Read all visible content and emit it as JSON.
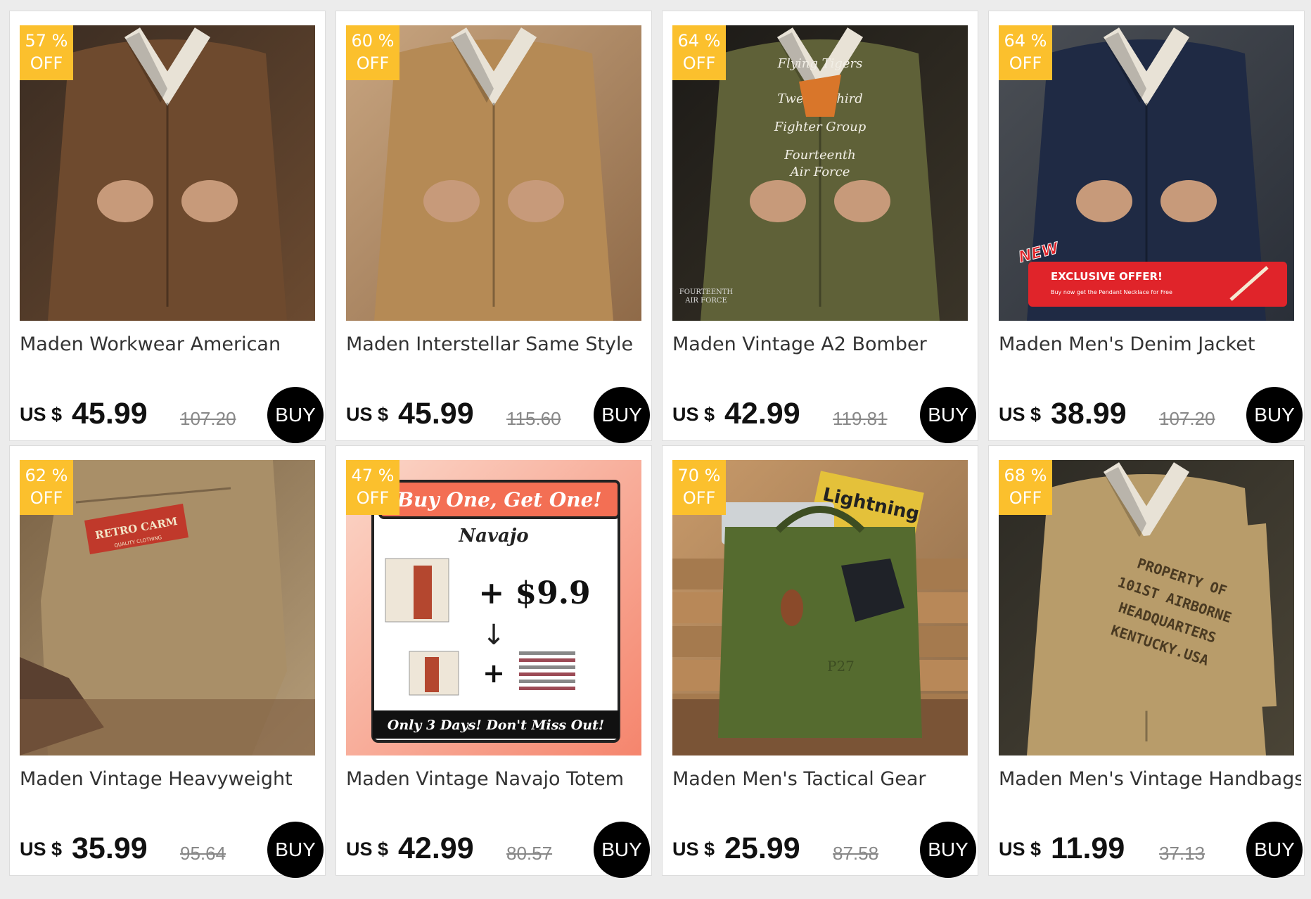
{
  "products": [
    {
      "discount_pct": "57 %",
      "off": "OFF",
      "title": "Maden Workwear American",
      "currency": "US $",
      "price": "45.99",
      "original_price": "107.20",
      "buy_label": "BUY",
      "image": "brown-work-jacket",
      "colors": {
        "bg1": "#3a2c22",
        "bg2": "#6b4a30",
        "main": "#6e4a2e"
      },
      "overlay": null
    },
    {
      "discount_pct": "60 %",
      "off": "OFF",
      "title": "Maden Interstellar Same Style",
      "currency": "US $",
      "price": "45.99",
      "original_price": "115.60",
      "buy_label": "BUY",
      "image": "tan-work-jacket",
      "colors": {
        "bg1": "#c8a580",
        "bg2": "#8f6a48",
        "main": "#b58a55"
      },
      "overlay": null
    },
    {
      "discount_pct": "64 %",
      "off": "OFF",
      "title": "Maden Vintage A2 Bomber",
      "currency": "US $",
      "price": "42.99",
      "original_price": "119.81",
      "buy_label": "BUY",
      "image": "green-bomber-jacket",
      "colors": {
        "bg1": "#1c1a17",
        "bg2": "#3a3428",
        "main": "#5f6138"
      },
      "overlay": {
        "kind": "embroidery",
        "lines": [
          "Flying Tigers",
          "Twenty Third",
          "Fighter Group",
          "Fourteenth",
          "Air Force"
        ],
        "corner": [
          "FOURTEENTH",
          "AIR FORCE"
        ]
      }
    },
    {
      "discount_pct": "64 %",
      "off": "OFF",
      "title": "Maden Men's Denim Jacket",
      "currency": "US $",
      "price": "38.99",
      "original_price": "107.20",
      "buy_label": "BUY",
      "image": "denim-jacket",
      "colors": {
        "bg1": "#4b4f55",
        "bg2": "#2a2f38",
        "main": "#1f2a44"
      },
      "overlay": {
        "kind": "promo",
        "new": "NEW",
        "headline": "EXCLUSIVE OFFER!",
        "sub": "Buy now get the Pendant Necklace for Free",
        "accent": "#e0242a"
      }
    },
    {
      "discount_pct": "62 %",
      "off": "OFF",
      "title": "Maden Vintage Heavyweight",
      "currency": "US $",
      "price": "35.99",
      "original_price": "95.64",
      "buy_label": "BUY",
      "image": "khaki-chino-pants",
      "colors": {
        "bg1": "#7a6245",
        "bg2": "#b49c78",
        "main": "#a98f68"
      },
      "overlay": {
        "kind": "label",
        "line1": "RETRO CARM",
        "line2": "QUALITY CLOTHING"
      }
    },
    {
      "discount_pct": "47 %",
      "off": "OFF",
      "title": "Maden Vintage Navajo Totem",
      "currency": "US $",
      "price": "42.99",
      "original_price": "80.57",
      "buy_label": "BUY",
      "image": "navajo-shorts-promo",
      "colors": {
        "bg1": "#fbd7c9",
        "bg2": "#f5856d",
        "main": "#eee6d8"
      },
      "overlay": {
        "kind": "bogo",
        "headline": "Buy One, Get One!",
        "name": "Navajo",
        "plus_price": "+ $9.9",
        "footer": "Only 3 Days! Don't Miss Out!"
      }
    },
    {
      "discount_pct": "70 %",
      "off": "OFF",
      "title": "Maden Men's Tactical Gear",
      "currency": "US $",
      "price": "25.99",
      "original_price": "87.58",
      "buy_label": "BUY",
      "image": "green-helmet-bag",
      "colors": {
        "bg1": "#c89a6a",
        "bg2": "#8c6a48",
        "main": "#556b2f"
      },
      "overlay": {
        "kind": "bag",
        "magazine": "Lightning",
        "stencil": "P27"
      }
    },
    {
      "discount_pct": "68 %",
      "off": "OFF",
      "title": "Maden Men's Vintage Handbags",
      "currency": "US $",
      "price": "11.99",
      "original_price": "37.13",
      "buy_label": "BUY",
      "image": "canvas-document-pouch",
      "colors": {
        "bg1": "#2c2a24",
        "bg2": "#4a4436",
        "main": "#b89c6a"
      },
      "overlay": {
        "kind": "stencil",
        "lines": [
          "PROPERTY OF",
          "101ST AIRBORNE",
          "HEADQUARTERS",
          "KENTUCKY.USA"
        ]
      }
    }
  ]
}
